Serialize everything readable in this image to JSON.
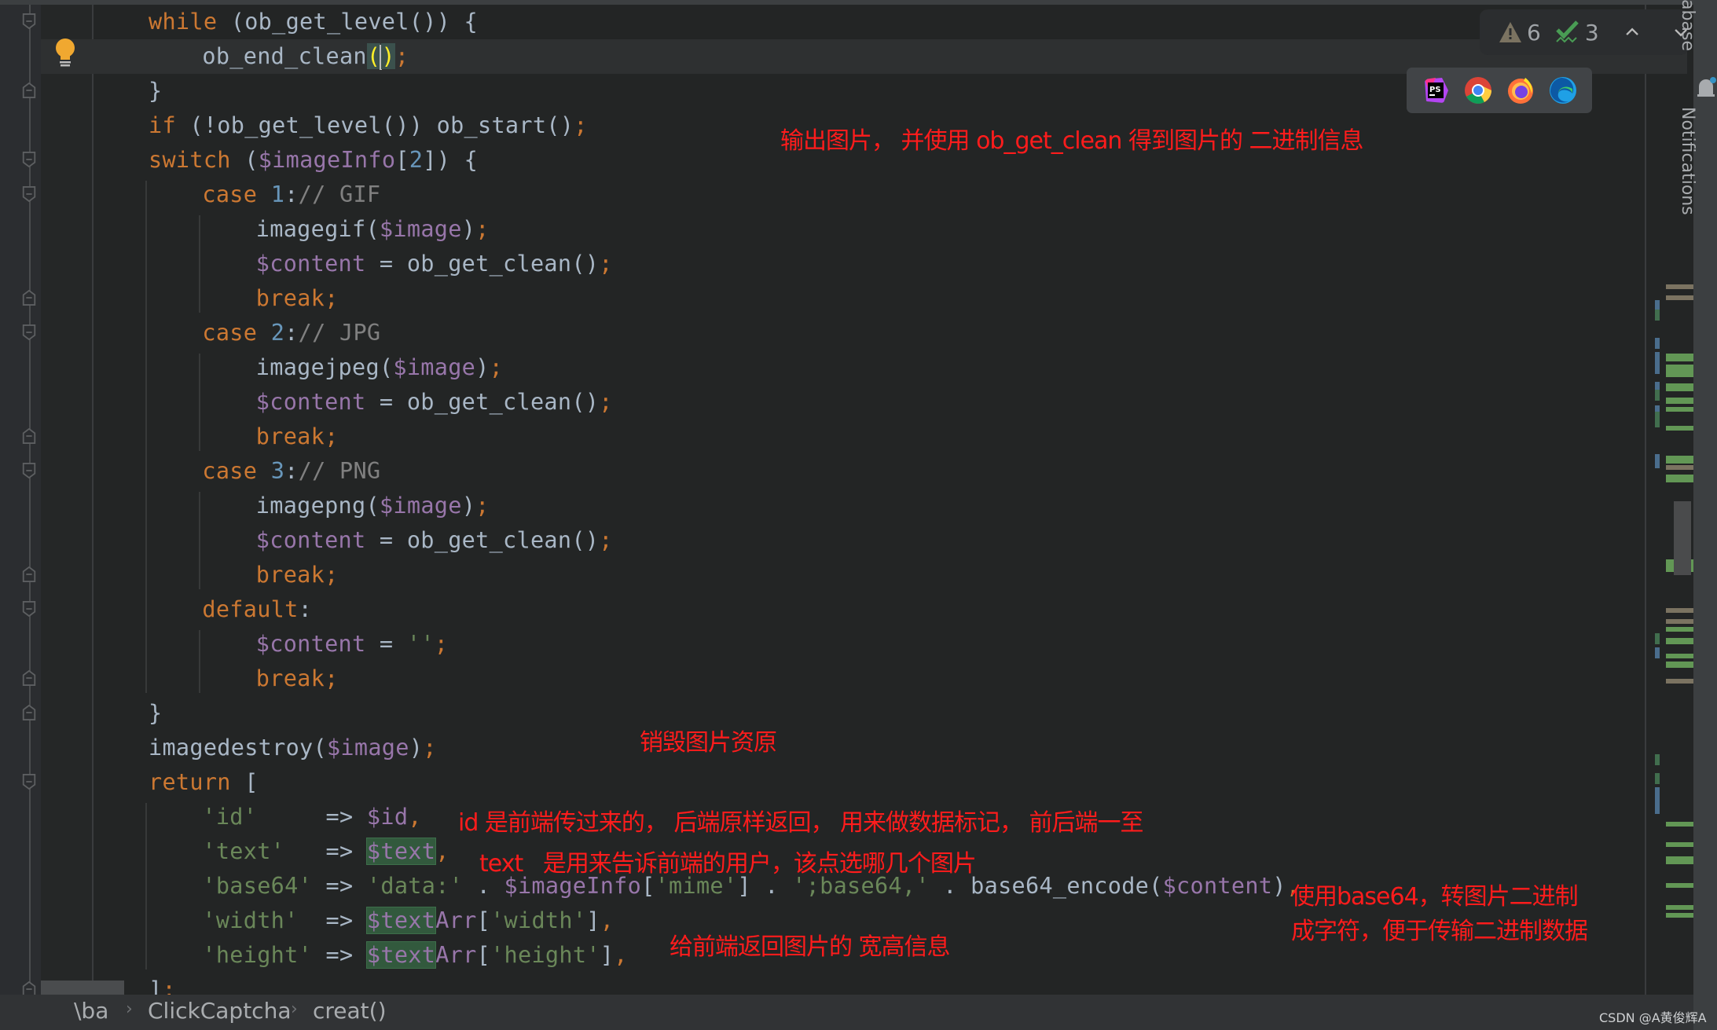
{
  "editor": {
    "lines": [
      {
        "indent": 0,
        "tokens": [
          {
            "t": "while",
            "c": "kw"
          },
          {
            "t": " (ob_get_level()) {",
            "c": "fn"
          }
        ]
      },
      {
        "indent": 1,
        "current": true,
        "tokens": [
          {
            "t": "ob_end_clean",
            "c": "fn"
          },
          {
            "t": "(",
            "c": "paren"
          },
          {
            "t": "",
            "c": "caret"
          },
          {
            "t": ")",
            "c": "paren"
          },
          {
            "t": ";",
            "c": "semi"
          }
        ]
      },
      {
        "indent": 0,
        "tokens": [
          {
            "t": "}",
            "c": "br"
          }
        ]
      },
      {
        "indent": 0,
        "tokens": [
          {
            "t": "if",
            "c": "kw"
          },
          {
            "t": " (!ob_get_level()) ob_start()",
            "c": "fn"
          },
          {
            "t": ";",
            "c": "semi"
          }
        ]
      },
      {
        "indent": 0,
        "tokens": [
          {
            "t": "switch",
            "c": "kw"
          },
          {
            "t": " (",
            "c": "fn"
          },
          {
            "t": "$imageInfo",
            "c": "var"
          },
          {
            "t": "[",
            "c": "fn"
          },
          {
            "t": "2",
            "c": "num"
          },
          {
            "t": "]) {",
            "c": "fn"
          }
        ]
      },
      {
        "indent": 1,
        "tokens": [
          {
            "t": "case ",
            "c": "kw"
          },
          {
            "t": "1",
            "c": "num"
          },
          {
            "t": ":",
            "c": "fn"
          },
          {
            "t": "// GIF",
            "c": "cm"
          }
        ]
      },
      {
        "indent": 2,
        "tokens": [
          {
            "t": "imagegif(",
            "c": "fn"
          },
          {
            "t": "$image",
            "c": "var"
          },
          {
            "t": ")",
            "c": "fn"
          },
          {
            "t": ";",
            "c": "semi"
          }
        ]
      },
      {
        "indent": 2,
        "tokens": [
          {
            "t": "$content",
            "c": "var"
          },
          {
            "t": " = ob_get_clean()",
            "c": "fn"
          },
          {
            "t": ";",
            "c": "semi"
          }
        ]
      },
      {
        "indent": 2,
        "tokens": [
          {
            "t": "break;",
            "c": "kw"
          }
        ]
      },
      {
        "indent": 1,
        "tokens": [
          {
            "t": "case ",
            "c": "kw"
          },
          {
            "t": "2",
            "c": "num"
          },
          {
            "t": ":",
            "c": "fn"
          },
          {
            "t": "// JPG",
            "c": "cm"
          }
        ]
      },
      {
        "indent": 2,
        "tokens": [
          {
            "t": "imagejpeg(",
            "c": "fn"
          },
          {
            "t": "$image",
            "c": "var"
          },
          {
            "t": ")",
            "c": "fn"
          },
          {
            "t": ";",
            "c": "semi"
          }
        ]
      },
      {
        "indent": 2,
        "tokens": [
          {
            "t": "$content",
            "c": "var"
          },
          {
            "t": " = ob_get_clean()",
            "c": "fn"
          },
          {
            "t": ";",
            "c": "semi"
          }
        ]
      },
      {
        "indent": 2,
        "tokens": [
          {
            "t": "break;",
            "c": "kw"
          }
        ]
      },
      {
        "indent": 1,
        "tokens": [
          {
            "t": "case ",
            "c": "kw"
          },
          {
            "t": "3",
            "c": "num"
          },
          {
            "t": ":",
            "c": "fn"
          },
          {
            "t": "// PNG",
            "c": "cm"
          }
        ]
      },
      {
        "indent": 2,
        "tokens": [
          {
            "t": "imagepng(",
            "c": "fn"
          },
          {
            "t": "$image",
            "c": "var"
          },
          {
            "t": ")",
            "c": "fn"
          },
          {
            "t": ";",
            "c": "semi"
          }
        ]
      },
      {
        "indent": 2,
        "tokens": [
          {
            "t": "$content",
            "c": "var"
          },
          {
            "t": " = ob_get_clean()",
            "c": "fn"
          },
          {
            "t": ";",
            "c": "semi"
          }
        ]
      },
      {
        "indent": 2,
        "tokens": [
          {
            "t": "break;",
            "c": "kw"
          }
        ]
      },
      {
        "indent": 1,
        "tokens": [
          {
            "t": "default",
            "c": "kw"
          },
          {
            "t": ":",
            "c": "fn"
          }
        ]
      },
      {
        "indent": 2,
        "tokens": [
          {
            "t": "$content",
            "c": "var"
          },
          {
            "t": " = ",
            "c": "fn"
          },
          {
            "t": "''",
            "c": "str"
          },
          {
            "t": ";",
            "c": "semi"
          }
        ]
      },
      {
        "indent": 2,
        "tokens": [
          {
            "t": "break;",
            "c": "kw"
          }
        ]
      },
      {
        "indent": 0,
        "tokens": [
          {
            "t": "}",
            "c": "br"
          }
        ]
      },
      {
        "indent": 0,
        "tokens": [
          {
            "t": "imagedestroy(",
            "c": "fn"
          },
          {
            "t": "$image",
            "c": "var"
          },
          {
            "t": ")",
            "c": "fn"
          },
          {
            "t": ";",
            "c": "semi"
          }
        ]
      },
      {
        "indent": 0,
        "tokens": [
          {
            "t": "return",
            "c": "kw"
          },
          {
            "t": " [",
            "c": "fn"
          }
        ]
      },
      {
        "indent": 1,
        "tokens": [
          {
            "t": "'id'",
            "c": "str"
          },
          {
            "t": "     => ",
            "c": "fn"
          },
          {
            "t": "$id",
            "c": "var"
          },
          {
            "t": ",",
            "c": "semi"
          }
        ]
      },
      {
        "indent": 1,
        "tokens": [
          {
            "t": "'text'",
            "c": "str"
          },
          {
            "t": "   => ",
            "c": "fn"
          },
          {
            "t": "$text",
            "c": "var hl"
          },
          {
            "t": ",",
            "c": "semi"
          }
        ]
      },
      {
        "indent": 1,
        "tokens": [
          {
            "t": "'base64'",
            "c": "str"
          },
          {
            "t": " => ",
            "c": "fn"
          },
          {
            "t": "'data:'",
            "c": "str"
          },
          {
            "t": " . ",
            "c": "fn"
          },
          {
            "t": "$imageInfo",
            "c": "var"
          },
          {
            "t": "[",
            "c": "fn"
          },
          {
            "t": "'mime'",
            "c": "str"
          },
          {
            "t": "] . ",
            "c": "fn"
          },
          {
            "t": "';base64,'",
            "c": "str"
          },
          {
            "t": " . base64_encode(",
            "c": "fn"
          },
          {
            "t": "$content",
            "c": "var"
          },
          {
            "t": ")",
            "c": "fn"
          },
          {
            "t": ",",
            "c": "semi"
          }
        ]
      },
      {
        "indent": 1,
        "tokens": [
          {
            "t": "'width'",
            "c": "str"
          },
          {
            "t": "  => ",
            "c": "fn"
          },
          {
            "t": "$text",
            "c": "var hl"
          },
          {
            "t": "Arr",
            "c": "var"
          },
          {
            "t": "[",
            "c": "fn"
          },
          {
            "t": "'width'",
            "c": "str"
          },
          {
            "t": "]",
            "c": "fn"
          },
          {
            "t": ",",
            "c": "semi"
          }
        ]
      },
      {
        "indent": 1,
        "tokens": [
          {
            "t": "'height'",
            "c": "str"
          },
          {
            "t": " => ",
            "c": "fn"
          },
          {
            "t": "$text",
            "c": "var hl"
          },
          {
            "t": "Arr",
            "c": "var"
          },
          {
            "t": "[",
            "c": "fn"
          },
          {
            "t": "'height'",
            "c": "str"
          },
          {
            "t": "]",
            "c": "fn"
          },
          {
            "t": ",",
            "c": "semi"
          }
        ]
      },
      {
        "indent": 0,
        "tokens": [
          {
            "t": "]",
            "c": "fn"
          },
          {
            "t": ";",
            "c": "semi"
          }
        ]
      }
    ]
  },
  "annotations": {
    "ob_clean": "输出图片， 并使用 ob_get_clean 得到图片的 二进制信息",
    "destroy": "销毁图片资原",
    "id": "id 是前端传过来的， 后端原样返回， 用来做数据标记， 前后端一至",
    "text": "text   是用来告诉前端的用户，该点选哪几个图片",
    "base64_1": "使用base64，转图片二进制",
    "base64_2": "成字符，便于传输二进制数据",
    "size": "给前端返回图片的 宽高信息"
  },
  "inspection": {
    "warnings": "6",
    "typos": "3"
  },
  "browsers": [
    "phpstorm",
    "chrome",
    "firefox",
    "edge"
  ],
  "right_panel": {
    "database_label": "Database",
    "notifications_label": "Notifications"
  },
  "breadcrumb": [
    "\\ba",
    "ClickCaptcha",
    "creat()"
  ],
  "watermark": "CSDN @A黄俊辉A",
  "colors": {
    "keyword": "#cc7832",
    "variable": "#9876aa",
    "string": "#6a8759",
    "number": "#6897bb",
    "comment": "#808080",
    "annotation": "#ff1c1c"
  }
}
